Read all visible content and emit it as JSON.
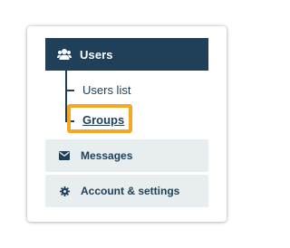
{
  "nav": {
    "header": {
      "icon": "users-icon",
      "label": "Users"
    },
    "submenu": [
      {
        "label": "Users list",
        "active": false
      },
      {
        "label": "Groups",
        "active": true
      }
    ],
    "items": [
      {
        "icon": "envelope-icon",
        "label": "Messages"
      },
      {
        "icon": "gear-icon",
        "label": "Account & settings"
      }
    ]
  },
  "colors": {
    "header_bg": "#20405a",
    "row_bg": "#e8eeef",
    "highlight": "#f5a623",
    "text": "#20405a"
  }
}
